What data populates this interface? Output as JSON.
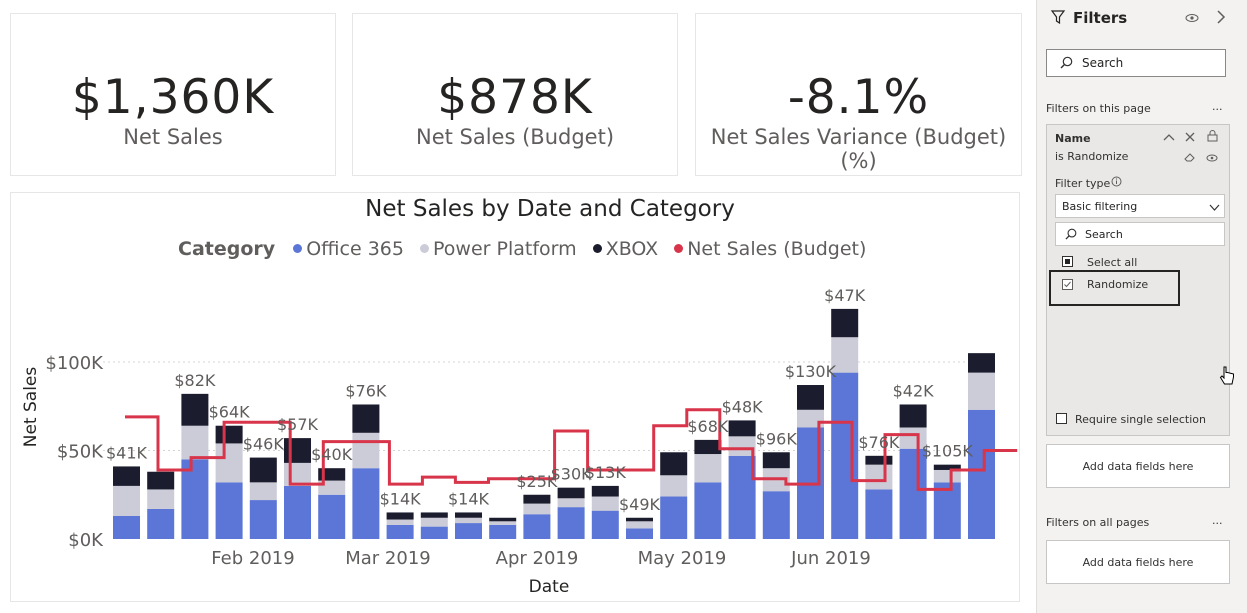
{
  "kpis": [
    {
      "value": "$1,360K",
      "label": "Net Sales",
      "color": "#252423"
    },
    {
      "value": "$878K",
      "label": "Net Sales (Budget)",
      "color": "#252423"
    },
    {
      "value": "-8.1%",
      "label": "Net Sales Variance (Budget) (%)",
      "color": "#252423"
    }
  ],
  "chart": {
    "title": "Net Sales by Date and Category",
    "legend_title": "Category",
    "legend": [
      {
        "name": "Office 365",
        "color": "#5b76d6"
      },
      {
        "name": "Power Platform",
        "color": "#ccccd8"
      },
      {
        "name": "XBOX",
        "color": "#1b1c2e"
      },
      {
        "name": "Net Sales (Budget)",
        "color": "#d8344a"
      }
    ]
  },
  "chart_data": {
    "type": "bar",
    "stacked": true,
    "title": "Net Sales by Date and Category",
    "xlabel": "Date",
    "ylabel": "Net Sales",
    "ylim": [
      0,
      110000
    ],
    "y_ticks": [
      "$0K",
      "$50K",
      "$100K"
    ],
    "x_ticks": [
      "Feb 2019",
      "Mar 2019",
      "Apr 2019",
      "May 2019",
      "Jun 2019"
    ],
    "grid": true,
    "legend_position": "top",
    "total_labels": [
      "$41K",
      "",
      "$82K",
      "$64K",
      "$46K",
      "$57K",
      "$40K",
      "$76K",
      "$14K",
      "",
      "$14K",
      "",
      "$25K",
      "$30K",
      "$13K",
      "$49K",
      "",
      "$68K",
      "$48K",
      "$96K",
      "$130K",
      "$47K",
      "$76K",
      "$42K",
      "$105K"
    ],
    "series": [
      {
        "name": "Office 365",
        "values": [
          13000,
          17000,
          45000,
          32000,
          22000,
          30000,
          25000,
          40000,
          8000,
          7000,
          9000,
          8000,
          14000,
          18000,
          16000,
          6000,
          24000,
          32000,
          47000,
          27000,
          63000,
          94000,
          28000,
          51000,
          32000,
          73000
        ]
      },
      {
        "name": "Power Platform",
        "values": [
          17000,
          11000,
          19000,
          22000,
          10000,
          13000,
          8000,
          20000,
          3000,
          5000,
          3000,
          2000,
          6000,
          5000,
          8000,
          4000,
          12000,
          16000,
          11000,
          13000,
          10000,
          20000,
          14000,
          12000,
          7000,
          21000
        ]
      },
      {
        "name": "XBOX",
        "values": [
          11000,
          10000,
          18000,
          10000,
          14000,
          14000,
          7000,
          16000,
          4000,
          3000,
          3000,
          2000,
          5000,
          6000,
          6000,
          2000,
          13000,
          8000,
          9000,
          9000,
          14000,
          16000,
          5000,
          13000,
          3000,
          11000
        ]
      },
      {
        "name": "Net Sales (Budget)",
        "type": "step-line",
        "values": [
          69000,
          39000,
          46000,
          66000,
          66000,
          31000,
          55000,
          55000,
          31000,
          35000,
          32000,
          34000,
          34000,
          61000,
          39000,
          39000,
          64000,
          73000,
          51000,
          34000,
          31000,
          66000,
          33000,
          59000,
          28000,
          39000,
          50000
        ]
      }
    ]
  },
  "filters": {
    "title": "Filters",
    "search_placeholder": "Search",
    "on_this_page": "Filters on this page",
    "card_name": "Name",
    "card_condition": "is Randomize",
    "filter_type_label": "Filter type",
    "filter_type_value": "Basic filtering",
    "card_search": "Search",
    "select_all": "Select all",
    "option": "Randomize",
    "require_single": "Require single selection",
    "add_fields_1": "Add data fields here",
    "on_all_pages": "Filters on all pages",
    "add_fields_2": "Add data fields here",
    "more": "...",
    "icons": [
      "filter-icon",
      "eye-icon",
      "chevron-right-icon",
      "search-icon",
      "collapse-icon",
      "close-icon",
      "lock-icon",
      "eraser-icon",
      "info-icon",
      "chevron-down-icon"
    ]
  }
}
